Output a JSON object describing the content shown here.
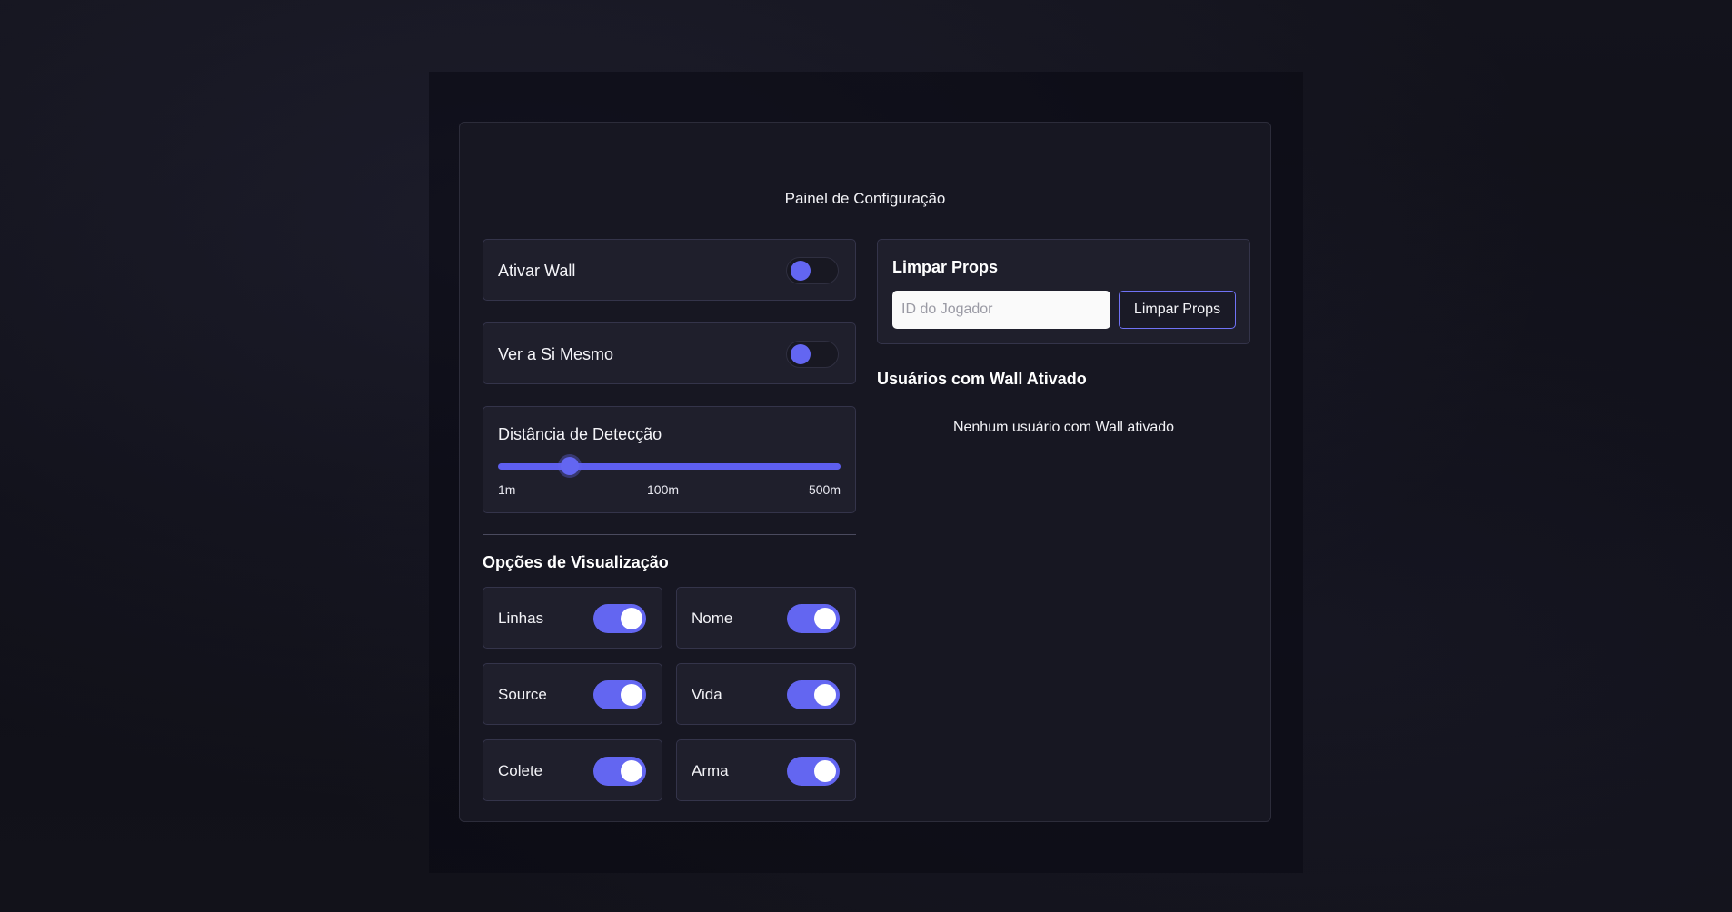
{
  "panel": {
    "title": "Painel de Configuração"
  },
  "toggles": {
    "wall": {
      "label": "Ativar Wall"
    },
    "self": {
      "label": "Ver a Si Mesmo"
    }
  },
  "distance": {
    "label": "Distância de Detecção",
    "ticks": [
      "1m",
      "100m",
      "500m"
    ],
    "value_label": "100m"
  },
  "view_options": {
    "title": "Opções de Visualização",
    "items": [
      {
        "label": "Linhas",
        "enabled": true
      },
      {
        "label": "Nome",
        "enabled": true
      },
      {
        "label": "Source",
        "enabled": true
      },
      {
        "label": "Vida",
        "enabled": true
      },
      {
        "label": "Colete",
        "enabled": true
      },
      {
        "label": "Arma",
        "enabled": true
      }
    ]
  },
  "clear_props": {
    "title": "Limpar Props",
    "input_placeholder": "ID do Jogador",
    "input_value": "",
    "button_label": "Limpar Props"
  },
  "wall_users": {
    "title": "Usuários com Wall Ativado",
    "empty_text": "Nenhum usuário com Wall ativado"
  },
  "colors": {
    "accent": "#6366f1",
    "panel_bg": "#171722",
    "card_bg": "#1f1f2c"
  }
}
